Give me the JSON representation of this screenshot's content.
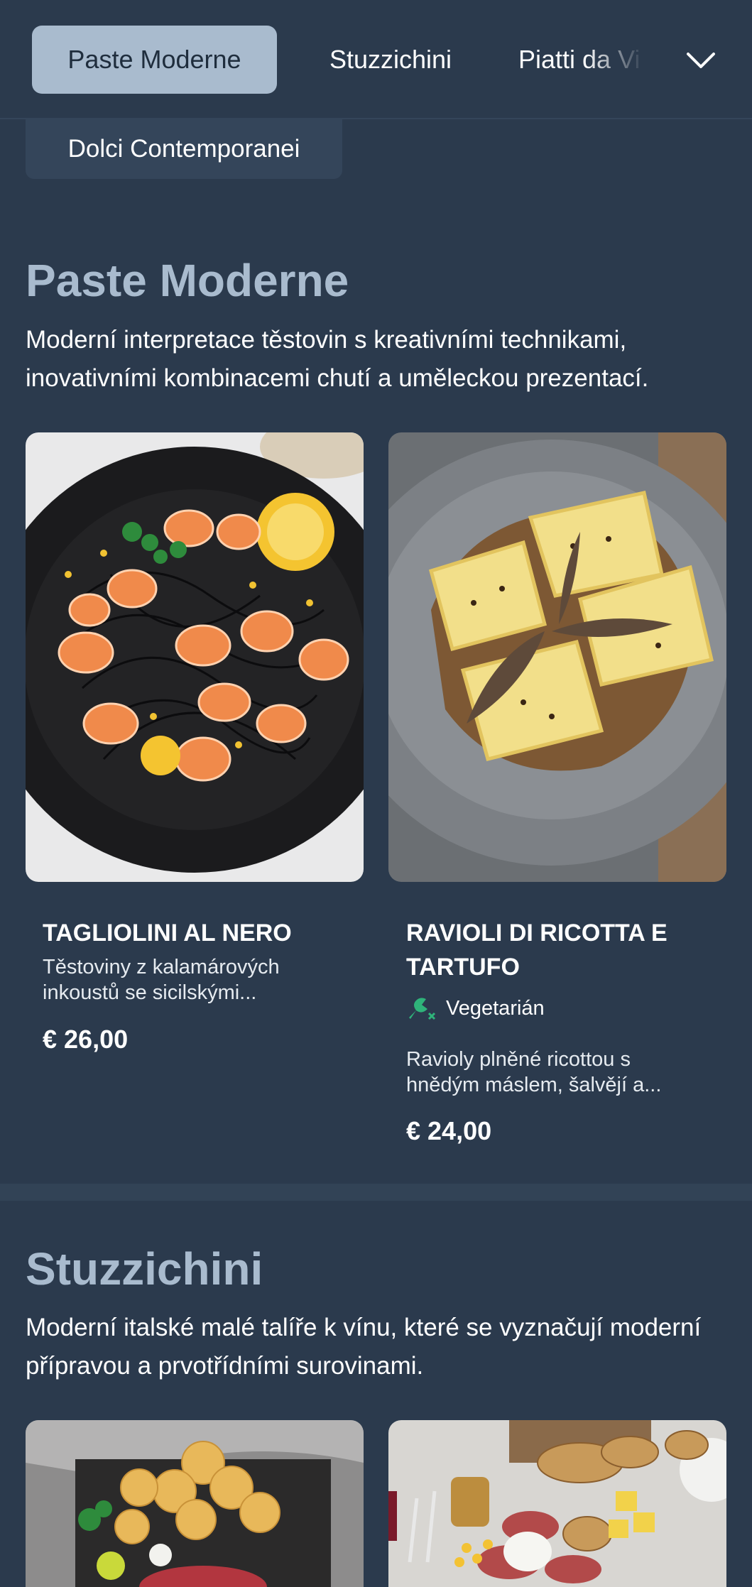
{
  "nav": {
    "tabs": [
      "Paste Moderne",
      "Stuzzichini",
      "Piatti da Vi"
    ],
    "active_tab": "Paste Moderne",
    "second_row_tab": "Dolci Contemporanei"
  },
  "sections": [
    {
      "title": "Paste Moderne",
      "description": "Moderní interpretace těstovin s kreativními technikami, inovativními kombinacemi chutí a uměleckou prezentací.",
      "items": [
        {
          "name": "TAGLIOLINI AL NERO",
          "description_line1": "Těstoviny z kalamárových",
          "description_line2": "inkoustů se sicilskými...",
          "price": "€ 26,00"
        },
        {
          "name_line1": "RAVIOLI DI RICOTTA E",
          "name_line2": "TARTUFO",
          "badge": "Vegetarián",
          "description_line1": "Ravioly plněné ricottou s",
          "description_line2": "hnědým máslem, šalvějí a...",
          "price": "€ 24,00"
        }
      ]
    },
    {
      "title": "Stuzzichini",
      "description": "Moderní italské malé talíře k vínu, které se vyznačují moderní přípravou a prvotřídními surovinami."
    }
  ],
  "colors": {
    "background": "#2b3a4d",
    "active_tab": "#a9bbce",
    "section_title": "#a9bbce",
    "veg_icon": "#2fb37a"
  }
}
